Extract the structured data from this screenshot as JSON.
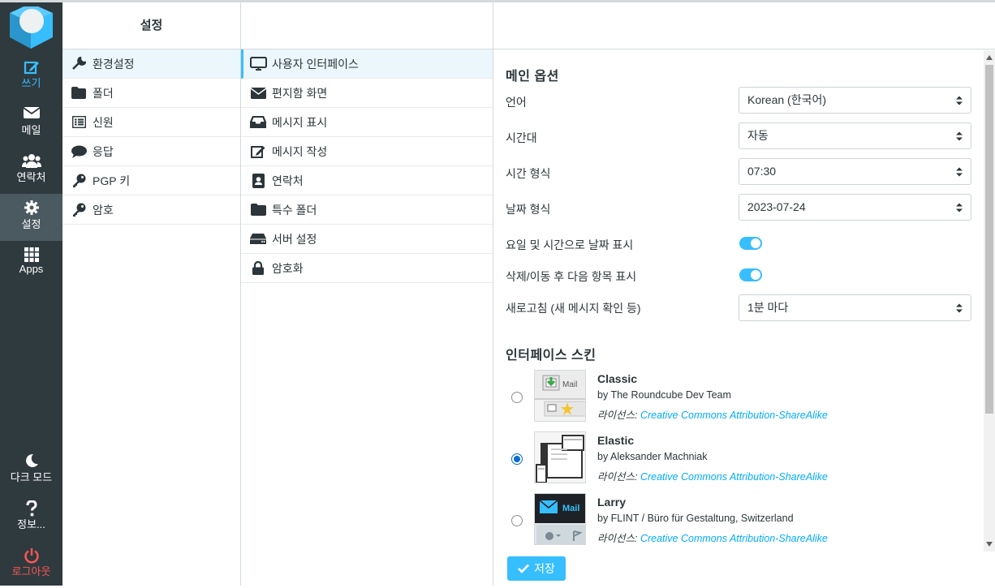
{
  "nav": {
    "compose": "쓰기",
    "mail": "메일",
    "contacts": "연락처",
    "settings": "설정",
    "apps": "Apps",
    "dark_mode": "다크 모드",
    "about": "정보...",
    "logout": "로그아웃"
  },
  "sections": {
    "header": "설정",
    "items": [
      {
        "label": "환경설정",
        "icon": "wrench-icon"
      },
      {
        "label": "폴더",
        "icon": "folder-icon"
      },
      {
        "label": "신원",
        "icon": "identity-list-icon"
      },
      {
        "label": "응답",
        "icon": "speech-bubble-icon"
      },
      {
        "label": "PGP 키",
        "icon": "key-icon"
      },
      {
        "label": "암호",
        "icon": "key-icon"
      }
    ]
  },
  "prefs": {
    "items": [
      {
        "label": "사용자 인터페이스",
        "icon": "monitor-icon"
      },
      {
        "label": "편지함 화면",
        "icon": "envelope-icon"
      },
      {
        "label": "메시지 표시",
        "icon": "inbox-tray-icon"
      },
      {
        "label": "메시지 작성",
        "icon": "edit-icon"
      },
      {
        "label": "연락처",
        "icon": "address-book-icon"
      },
      {
        "label": "특수 폴더",
        "icon": "folder-icon"
      },
      {
        "label": "서버 설정",
        "icon": "server-icon"
      },
      {
        "label": "암호화",
        "icon": "lock-icon"
      }
    ]
  },
  "main": {
    "title": "메인 옵션",
    "language_label": "언어",
    "language_value": "Korean (한국어)",
    "timezone_label": "시간대",
    "timezone_value": "자동",
    "time_format_label": "시간 형식",
    "time_format_value": "07:30",
    "date_format_label": "날짜 형식",
    "date_format_value": "2023-07-24",
    "pretty_date_label": "요일 및 시간으로 날짜 표시",
    "pretty_date_on": true,
    "display_next_label": "삭제/이동 후 다음 항목 표시",
    "display_next_on": true,
    "refresh_label": "새로고침 (새 메시지 확인 등)",
    "refresh_value": "1분 마다"
  },
  "skins": {
    "title": "인터페이스 스킨",
    "license_prefix": "라이선스:",
    "items": [
      {
        "name": "Classic",
        "by": "by The Roundcube Dev Team",
        "license": "Creative Commons Attribution-ShareAlike",
        "checked": false
      },
      {
        "name": "Elastic",
        "by": "by Aleksander Machniak",
        "license": "Creative Commons Attribution-ShareAlike",
        "checked": true
      },
      {
        "name": "Larry",
        "by": "by FLINT / Büro für Gestaltung, Switzerland",
        "license": "Creative Commons Attribution-ShareAlike",
        "checked": false
      }
    ],
    "thumb_mail_text": "Mail"
  },
  "save_label": "저장",
  "colors": {
    "accent": "#37beff",
    "nav_bg": "#2f3a3f",
    "logout": "#ff5552"
  }
}
